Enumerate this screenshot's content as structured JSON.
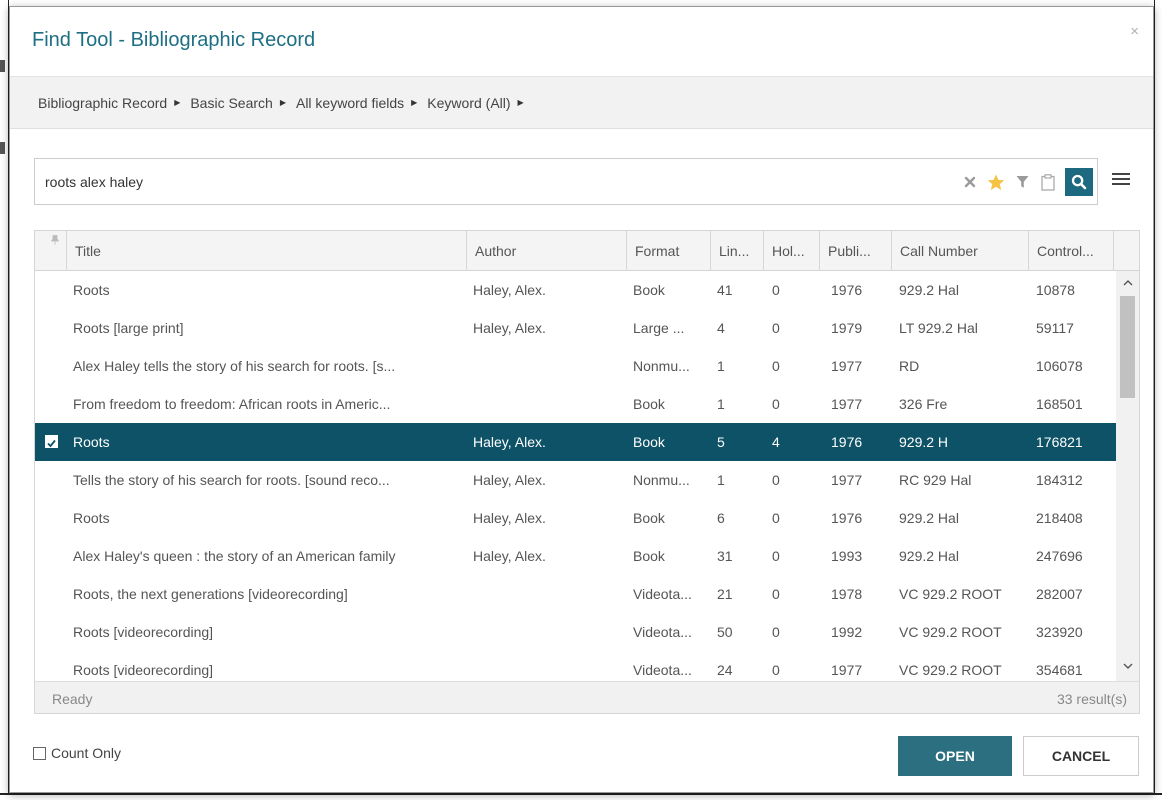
{
  "dialog": {
    "title": "Find Tool - Bibliographic Record",
    "close_label": "×"
  },
  "breadcrumb": [
    {
      "label": "Bibliographic Record"
    },
    {
      "label": "Basic Search"
    },
    {
      "label": "All keyword fields"
    },
    {
      "label": "Keyword (All)"
    }
  ],
  "search": {
    "value": "roots alex haley",
    "tools": [
      "clear-icon",
      "star-icon",
      "filter-icon",
      "clipboard-icon",
      "search-icon"
    ],
    "accent_color": "#1d6a80",
    "star_color": "#f5c242"
  },
  "grid": {
    "columns": [
      "Title",
      "Author",
      "Format",
      "Lin...",
      "Hol...",
      "Publi...",
      "Call Number",
      "Control..."
    ],
    "rows": [
      {
        "title": "Roots",
        "author": "Haley, Alex.",
        "format": "Book",
        "lin": "41",
        "hol": "0",
        "pub": "1976",
        "call": "929.2 Hal",
        "control": "10878",
        "selected": false
      },
      {
        "title": "Roots [large print]",
        "author": "Haley, Alex.",
        "format": "Large ...",
        "lin": "4",
        "hol": "0",
        "pub": "1979",
        "call": "LT 929.2 Hal",
        "control": "59117",
        "selected": false
      },
      {
        "title": "Alex Haley tells the story of his search for roots. [s...",
        "author": "",
        "format": "Nonmu...",
        "lin": "1",
        "hol": "0",
        "pub": "1977",
        "call": "RD",
        "control": "106078",
        "selected": false
      },
      {
        "title": "From freedom to freedom: African roots in Americ...",
        "author": "",
        "format": "Book",
        "lin": "1",
        "hol": "0",
        "pub": "1977",
        "call": "326 Fre",
        "control": "168501",
        "selected": false
      },
      {
        "title": "Roots",
        "author": "Haley, Alex.",
        "format": "Book",
        "lin": "5",
        "hol": "4",
        "pub": "1976",
        "call": "929.2 H",
        "control": "176821",
        "selected": true
      },
      {
        "title": "Tells the story of his search for roots. [sound reco...",
        "author": "Haley, Alex.",
        "format": "Nonmu...",
        "lin": "1",
        "hol": "0",
        "pub": "1977",
        "call": "RC 929 Hal",
        "control": "184312",
        "selected": false
      },
      {
        "title": "Roots",
        "author": "Haley, Alex.",
        "format": "Book",
        "lin": "6",
        "hol": "0",
        "pub": "1976",
        "call": "929.2 Hal",
        "control": "218408",
        "selected": false
      },
      {
        "title": "Alex Haley's queen : the story of an American family",
        "author": "Haley, Alex.",
        "format": "Book",
        "lin": "31",
        "hol": "0",
        "pub": "1993",
        "call": "929.2 Hal",
        "control": "247696",
        "selected": false
      },
      {
        "title": "Roots, the next generations [videorecording]",
        "author": "",
        "format": "Videota...",
        "lin": "21",
        "hol": "0",
        "pub": "1978",
        "call": "VC 929.2 ROOT",
        "control": "282007",
        "selected": false
      },
      {
        "title": "Roots [videorecording]",
        "author": "",
        "format": "Videota...",
        "lin": "50",
        "hol": "0",
        "pub": "1992",
        "call": "VC 929.2 ROOT",
        "control": "323920",
        "selected": false
      },
      {
        "title": "Roots [videorecording]",
        "author": "",
        "format": "Videota...",
        "lin": "24",
        "hol": "0",
        "pub": "1977",
        "call": "VC 929.2 ROOT",
        "control": "354681",
        "selected": false
      }
    ],
    "status": "Ready",
    "result_count": "33 result(s)",
    "selected_color": "#0e5267"
  },
  "footer": {
    "count_only_label": "Count Only",
    "open_label": "OPEN",
    "cancel_label": "CANCEL",
    "open_color": "#2c6f80"
  }
}
